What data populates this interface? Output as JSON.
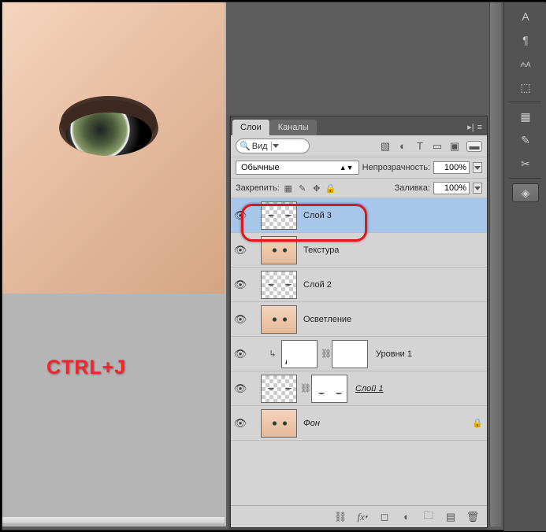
{
  "shortcut_text": "CTRL+J",
  "panel": {
    "tabs": [
      "Слои",
      "Каналы"
    ],
    "active_tab": 0,
    "search_label": "Вид",
    "blend_mode": "Обычные",
    "opacity_label": "Непрозрачность:",
    "opacity_value": "100%",
    "fill_label": "Заливка:",
    "fill_value": "100%",
    "lock_label": "Закрепить:"
  },
  "layers": [
    {
      "name": "Слой 3",
      "thumb": "checker-dots",
      "selected": true,
      "visible": true
    },
    {
      "name": "Текстура",
      "thumb": "face",
      "visible": true
    },
    {
      "name": "Слой 2",
      "thumb": "checker-dots",
      "visible": true
    },
    {
      "name": "Осветление",
      "thumb": "face",
      "visible": true
    },
    {
      "name": "Уровни 1",
      "thumb": "adjustment",
      "mask": "white",
      "indent": true,
      "visible": true,
      "linked": true
    },
    {
      "name": "Слой 1",
      "thumb": "checker-dots",
      "mask": "dots",
      "italic": true,
      "visible": true,
      "linked": true
    },
    {
      "name": "Фон",
      "thumb": "face",
      "italic": true,
      "locked": true,
      "visible": true
    }
  ],
  "footer_icons": [
    "link-icon",
    "fx-icon",
    "mask-icon",
    "adjustment-icon",
    "group-icon",
    "new-layer-icon",
    "trash-icon"
  ]
}
